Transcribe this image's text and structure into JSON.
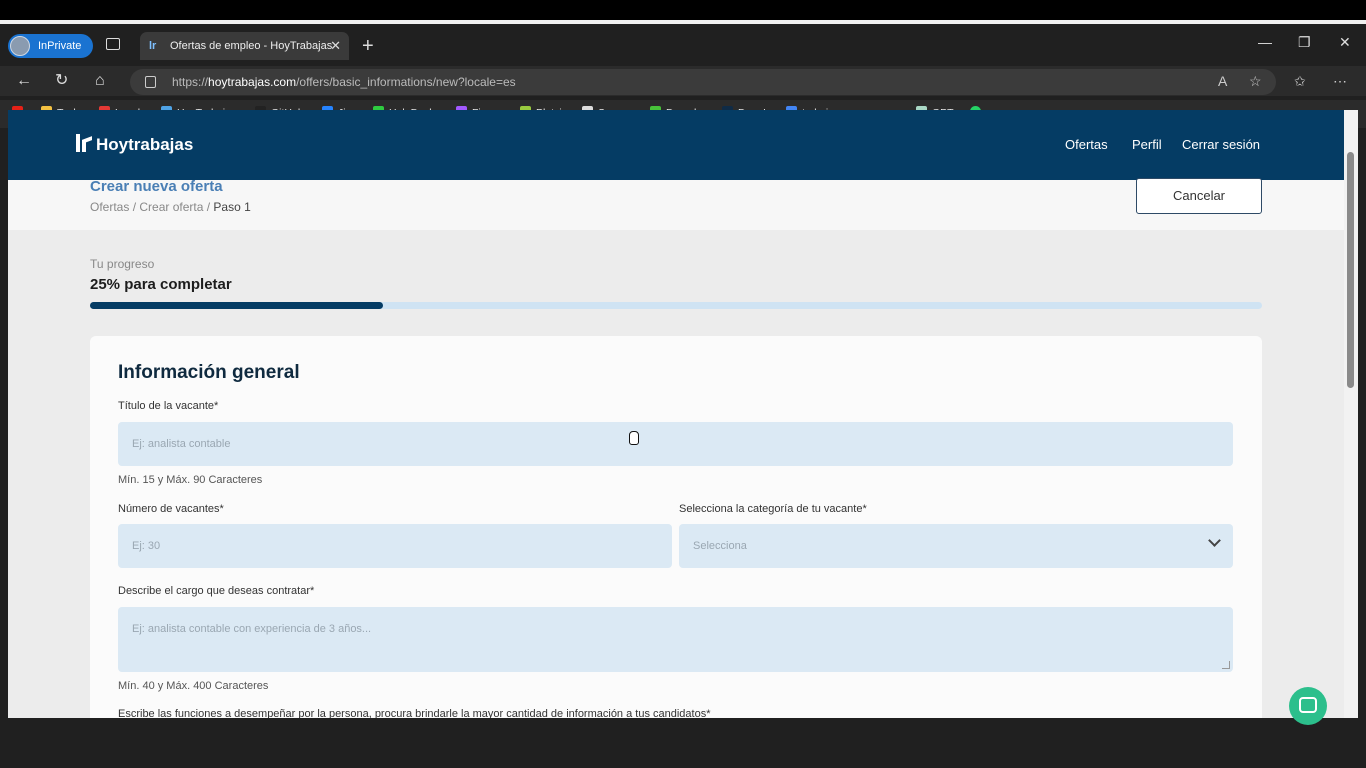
{
  "browser": {
    "inprivate_label": "InPrivate",
    "tab_title": "Ofertas de empleo - HoyTrabajas",
    "url_domain": "hoytrabajas.com",
    "url_prefix": "https://",
    "url_path": "/offers/basic_informations/new?locale=es"
  },
  "bookmarks": [
    {
      "label": "",
      "color": "#e62117"
    },
    {
      "label": "Tech",
      "color": "#f5c242"
    },
    {
      "label": "Local",
      "color": "#e53935"
    },
    {
      "label": "HoyTrabajas",
      "color": "#4fa3e6"
    },
    {
      "label": "GitHub",
      "color": "#222222"
    },
    {
      "label": "Jira",
      "color": "#2684ff"
    },
    {
      "label": "HelpDesk",
      "color": "#2ecc40"
    },
    {
      "label": "Figma",
      "color": "#a259ff"
    },
    {
      "label": "Platzi",
      "color": "#98ca3f"
    },
    {
      "label": "Scrumr",
      "color": "#dddddd"
    },
    {
      "label": "Dvorak",
      "color": "#47c23a"
    },
    {
      "label": "DeepL",
      "color": "#0f2b46"
    },
    {
      "label": "trabajo-procesos -...",
      "color": "#4285f4"
    },
    {
      "label": "GPT",
      "color": "#a9d8c5"
    },
    {
      "label": "a",
      "color": "#25d366"
    }
  ],
  "header": {
    "logo": "Hoytrabajas",
    "nav": [
      "Ofertas",
      "Perfil",
      "Cerrar sesión"
    ]
  },
  "page": {
    "title": "Crear nueva oferta",
    "crumb_1": "Ofertas",
    "crumb_2": "Crear oferta",
    "crumb_current": "Paso 1",
    "cancel_label": "Cancelar"
  },
  "progress": {
    "label": "Tu progreso",
    "text": "25% para completar",
    "value": 0.25
  },
  "form": {
    "section_title": "Información general",
    "title_label": "Título de la vacante*",
    "title_placeholder": "Ej: analista contable",
    "title_hint": "Mín. 15 y Máx. 90 Caracteres",
    "vacancies_label": "Número de vacantes*",
    "vacancies_placeholder": "Ej: 30",
    "category_label": "Selecciona la categoría de tu vacante*",
    "category_value": "Selecciona",
    "description_label": "Describe el cargo que deseas contratar*",
    "description_placeholder": "Ej: analista contable con experiencia de 3 años...",
    "description_hint": "Mín. 40 y Máx. 400 Caracteres",
    "functions_label": "Escribe las funciones a desempeñar por la persona, procura brindarle la mayor cantidad de información a tus candidatos*"
  },
  "colors": {
    "brand": "#053c64",
    "field": "#dbe9f4",
    "chat": "#2cbf8c"
  }
}
